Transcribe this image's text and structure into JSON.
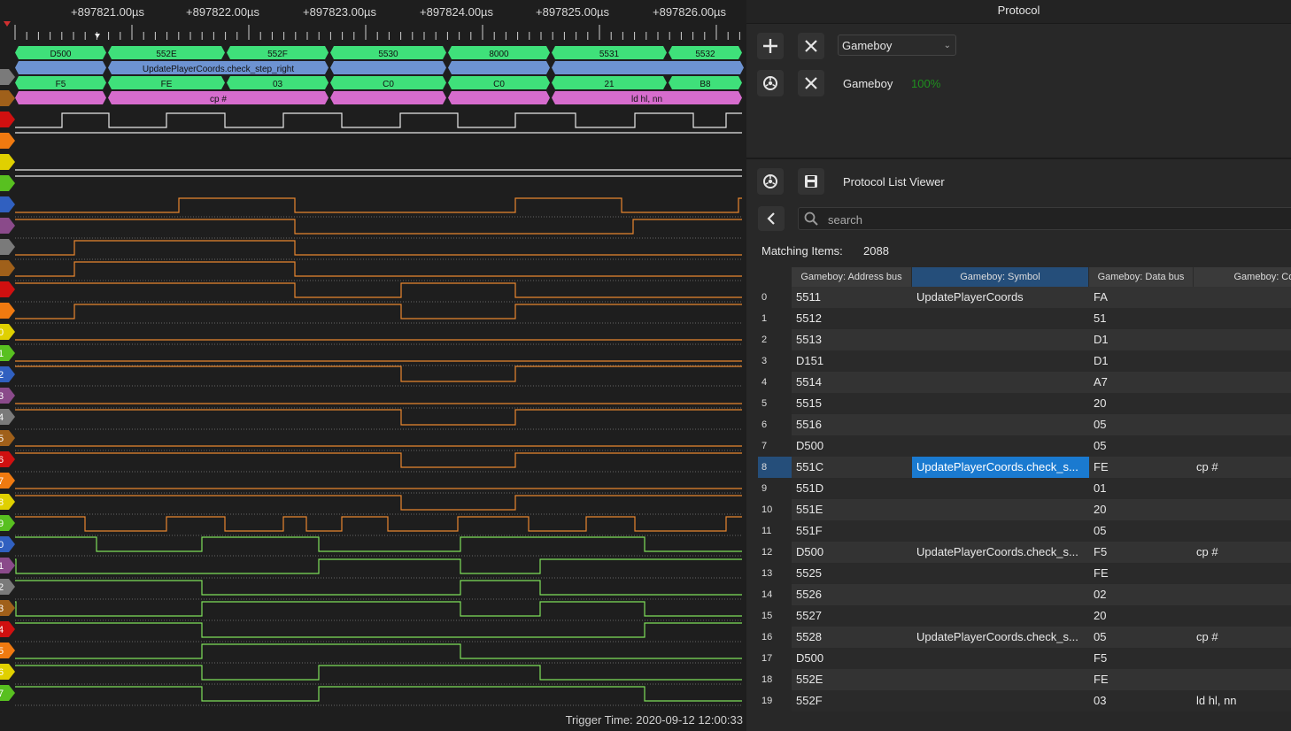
{
  "timeline": {
    "labels": [
      "+897821.00µs",
      "+897822.00µs",
      "+897823.00µs",
      "+897824.00µs",
      "+897825.00µs",
      "+897826.00µs"
    ]
  },
  "decoder_rows": {
    "address": [
      "D500",
      "552E",
      "552F",
      "5530",
      "8000",
      "5531",
      "5532"
    ],
    "symbol": [
      "UpdatePlayerCoords.check_step_right"
    ],
    "data": [
      "F5",
      "FE",
      "03",
      "C0",
      "C0",
      "21",
      "B8"
    ],
    "code": [
      "cp #",
      "ld hl, nn"
    ]
  },
  "channel_tab_numbers": [
    "0",
    "1",
    "2",
    "3",
    "4",
    "5",
    "6",
    "7",
    "8",
    "9",
    "0",
    "1",
    "2",
    "3",
    "4",
    "5",
    "6",
    "7"
  ],
  "trigger_time": "Trigger Time: 2020-09-12 12:00:33",
  "protocol_panel": {
    "title": "Protocol",
    "decoder_select_value": "Gameboy",
    "decoder_name": "Gameboy",
    "decoder_progress": "100%",
    "progress_color": "#1f8f1f"
  },
  "list_viewer": {
    "title": "Protocol List Viewer",
    "search_placeholder": "search",
    "matching_label": "Matching Items:",
    "matching_count": "2088",
    "columns": [
      "Gameboy: Address bus",
      "Gameboy: Symbol",
      "Gameboy: Data bus",
      "Gameboy: Cod"
    ],
    "rows": [
      {
        "idx": "0",
        "addr": "5511",
        "sym": "UpdatePlayerCoords",
        "data": "FA",
        "code": ""
      },
      {
        "idx": "1",
        "addr": "5512",
        "sym": "",
        "data": "51",
        "code": ""
      },
      {
        "idx": "2",
        "addr": "5513",
        "sym": "",
        "data": "D1",
        "code": ""
      },
      {
        "idx": "3",
        "addr": "D151",
        "sym": "",
        "data": "D1",
        "code": ""
      },
      {
        "idx": "4",
        "addr": "5514",
        "sym": "",
        "data": "A7",
        "code": ""
      },
      {
        "idx": "5",
        "addr": "5515",
        "sym": "",
        "data": "20",
        "code": ""
      },
      {
        "idx": "6",
        "addr": "5516",
        "sym": "",
        "data": "05",
        "code": ""
      },
      {
        "idx": "7",
        "addr": "D500",
        "sym": "",
        "data": "05",
        "code": ""
      },
      {
        "idx": "8",
        "addr": "551C",
        "sym": "UpdatePlayerCoords.check_s...",
        "data": "FE",
        "code": "cp #"
      },
      {
        "idx": "9",
        "addr": "551D",
        "sym": "",
        "data": "01",
        "code": ""
      },
      {
        "idx": "10",
        "addr": "551E",
        "sym": "",
        "data": "20",
        "code": ""
      },
      {
        "idx": "11",
        "addr": "551F",
        "sym": "",
        "data": "05",
        "code": ""
      },
      {
        "idx": "12",
        "addr": "D500",
        "sym": "UpdatePlayerCoords.check_s...",
        "data": "F5",
        "code": "cp #"
      },
      {
        "idx": "13",
        "addr": "5525",
        "sym": "",
        "data": "FE",
        "code": ""
      },
      {
        "idx": "14",
        "addr": "5526",
        "sym": "",
        "data": "02",
        "code": ""
      },
      {
        "idx": "15",
        "addr": "5527",
        "sym": "",
        "data": "20",
        "code": ""
      },
      {
        "idx": "16",
        "addr": "5528",
        "sym": "UpdatePlayerCoords.check_s...",
        "data": "05",
        "code": "cp #"
      },
      {
        "idx": "17",
        "addr": "D500",
        "sym": "",
        "data": "F5",
        "code": ""
      },
      {
        "idx": "18",
        "addr": "552E",
        "sym": "",
        "data": "FE",
        "code": ""
      },
      {
        "idx": "19",
        "addr": "552F",
        "sym": "",
        "data": "03",
        "code": "ld hl, nn"
      }
    ]
  },
  "colors": {
    "decode_green": "#3fe07a",
    "decode_blue": "#6d93d2",
    "decode_pink": "#d66ccd",
    "trace_orange": "#e8862f",
    "trace_green": "#7ee05a",
    "trace_white": "#e8e8e8",
    "selection_blue": "#1a7ad0"
  }
}
